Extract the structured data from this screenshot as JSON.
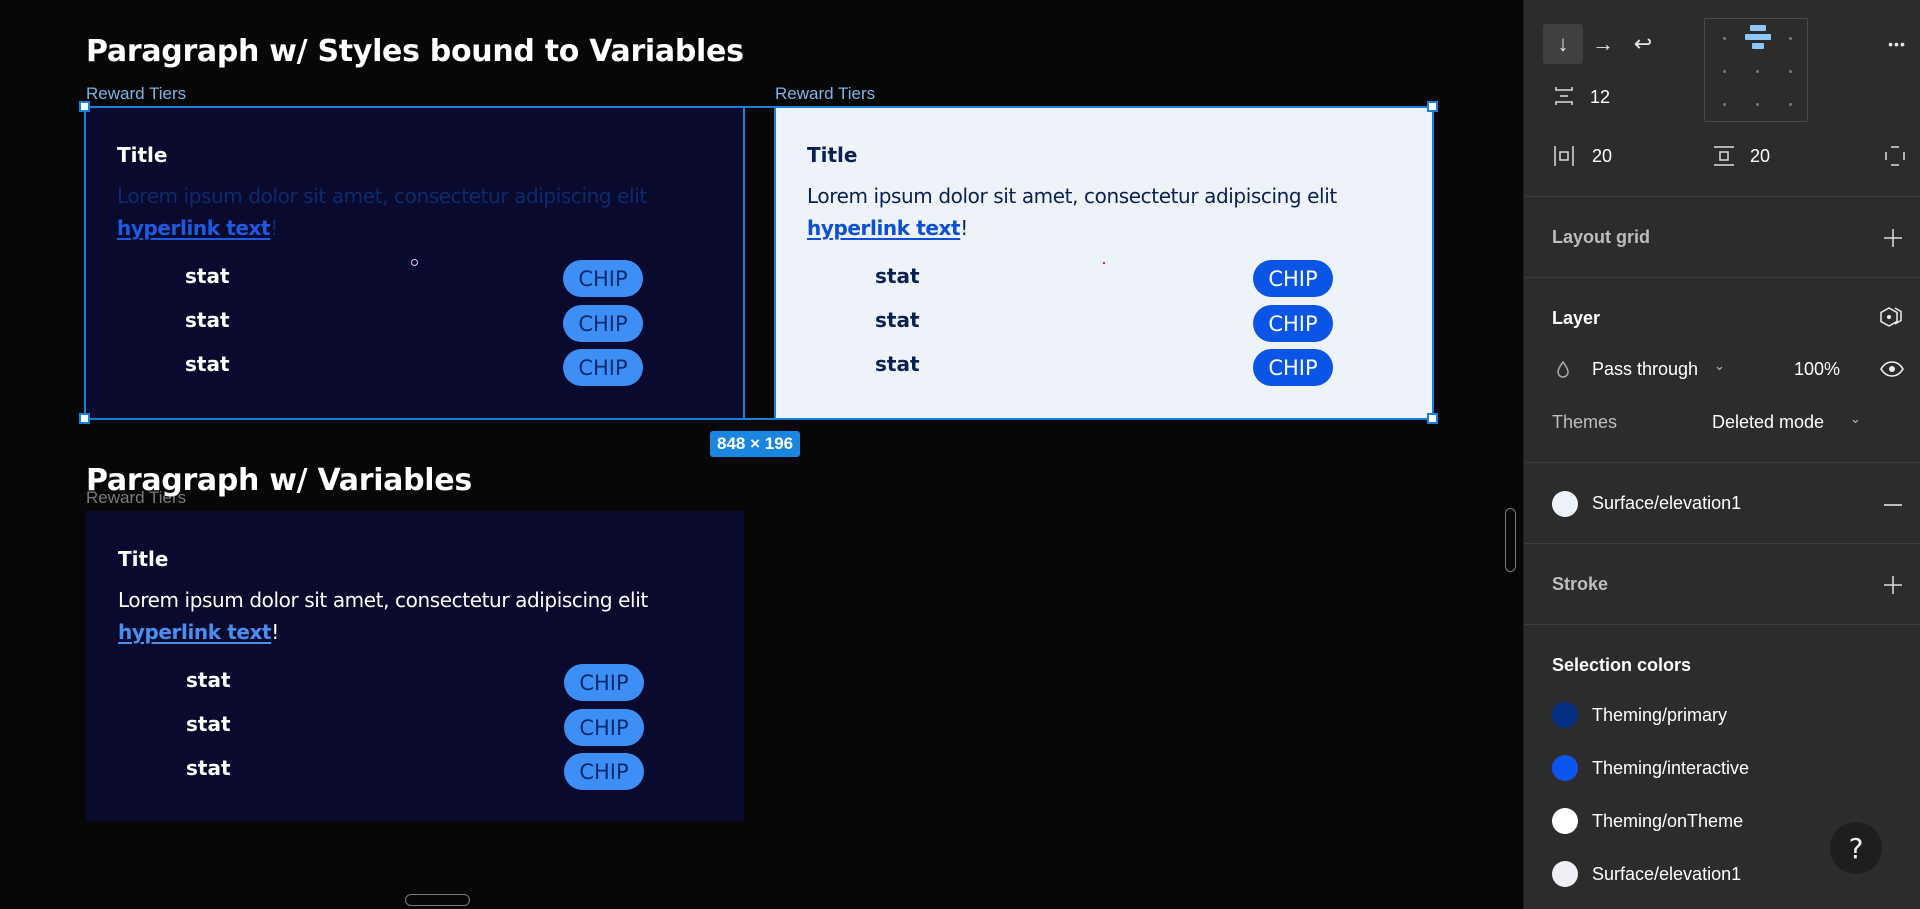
{
  "canvas": {
    "section1": {
      "heading": "Paragraph w/ Styles bound to Variables",
      "frames": [
        {
          "label": "Reward Tiers",
          "theme": "dark",
          "title": "Title",
          "body": "Lorem ipsum dolor sit amet, consectetur adipiscing elit",
          "link": "hyperlink text",
          "suffix": "!",
          "stats": [
            "stat",
            "stat",
            "stat"
          ],
          "chips": [
            "CHIP",
            "CHIP",
            "CHIP"
          ]
        },
        {
          "label": "Reward Tiers",
          "theme": "light",
          "title": "Title",
          "body": "Lorem ipsum dolor sit amet, consectetur adipiscing elit",
          "link": "hyperlink text",
          "suffix": "!",
          "stats": [
            "stat",
            "stat",
            "stat"
          ],
          "chips": [
            "CHIP",
            "CHIP",
            "CHIP"
          ]
        }
      ],
      "selection_size": "848 × 196"
    },
    "section2": {
      "heading": "Paragraph w/ Variables",
      "frame": {
        "label": "Reward Tiers",
        "theme": "dark",
        "title": "Title",
        "body": "Lorem ipsum dolor sit amet, consectetur adipiscing elit",
        "link": "hyperlink text",
        "suffix": "!",
        "stats": [
          "stat",
          "stat",
          "stat"
        ],
        "chips": [
          "CHIP",
          "CHIP",
          "CHIP"
        ]
      }
    }
  },
  "panel": {
    "auto_layout": {
      "direction_buttons": [
        {
          "icon": "arrow-down-icon",
          "glyph": "↓",
          "active": true
        },
        {
          "icon": "arrow-right-icon",
          "glyph": "→",
          "active": false
        },
        {
          "icon": "wrap-icon",
          "glyph": "↩",
          "active": false
        }
      ],
      "gap": "12",
      "padding_horizontal": "20",
      "padding_vertical": "20",
      "more_glyph": "•••"
    },
    "layout_grid": {
      "label": "Layout grid"
    },
    "layer": {
      "label": "Layer",
      "blend_mode": "Pass through",
      "opacity": "100%",
      "themes_label": "Themes",
      "themes_value": "Deleted mode"
    },
    "fill": {
      "name": "Surface/elevation1",
      "color": "#eef2fa"
    },
    "stroke": {
      "label": "Stroke"
    },
    "selection_colors": {
      "label": "Selection colors",
      "items": [
        {
          "name": "Theming/primary",
          "color": "#062f86"
        },
        {
          "name": "Theming/interactive",
          "color": "#0b55f0"
        },
        {
          "name": "Theming/onTheme",
          "color": "#ffffff"
        },
        {
          "name": "Surface/elevation1",
          "color": "#eef0f5"
        }
      ]
    },
    "help_glyph": "?"
  },
  "colors": {
    "canvas_bg": "#070707",
    "panel_bg": "#2c2c2c",
    "selection": "#1a7fd8",
    "dark_card": "#0a0a2e",
    "light_card": "#eef3fa"
  }
}
